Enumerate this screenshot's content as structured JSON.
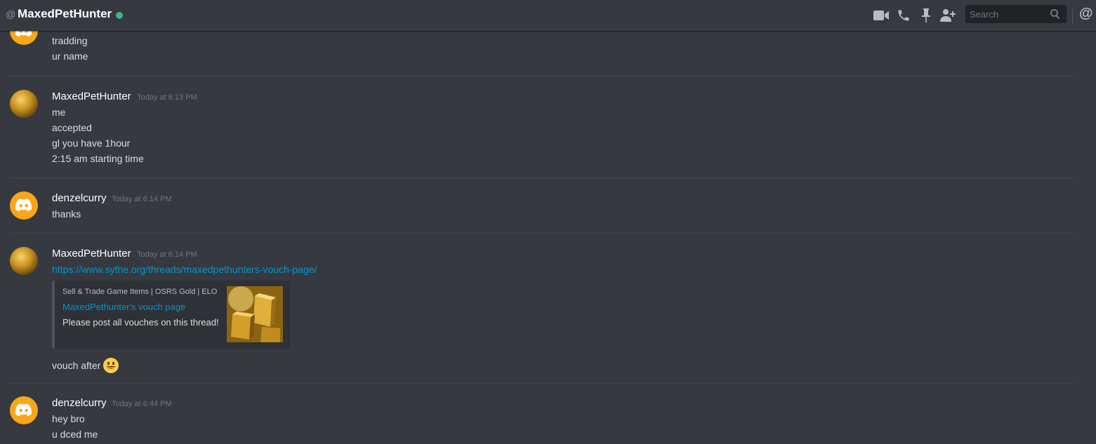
{
  "header": {
    "at_symbol": "@",
    "channel_name": "MaxedPetHunter",
    "status_color": "#43b581",
    "icons": [
      "video-call-icon",
      "voice-call-icon",
      "pin-icon",
      "add-friend-icon"
    ],
    "search_placeholder": "Search",
    "mention_symbol": "@"
  },
  "colors": {
    "background": "#36393f",
    "link": "#0096cf",
    "discord_avatar": "#faa61a",
    "online": "#43b581"
  },
  "messages": [
    {
      "author": "",
      "avatar": "discord-default",
      "lines": [
        "tradding",
        "ur name"
      ]
    },
    {
      "author": "MaxedPetHunter",
      "timestamp": "Today at 6:13 PM",
      "avatar": "gold-bars",
      "lines": [
        "me",
        "accepted",
        "gl you have 1hour",
        "2:15 am starting time"
      ]
    },
    {
      "author": "denzelcurry",
      "timestamp": "Today at 6:14 PM",
      "avatar": "discord-default",
      "lines": [
        "thanks"
      ]
    },
    {
      "author": "MaxedPetHunter",
      "timestamp": "Today at 6:14 PM",
      "avatar": "gold-bars",
      "link": "https://www.sythe.org/threads/maxedpethunters-vouch-page/",
      "embed": {
        "provider": "Sell & Trade Game Items | OSRS Gold | ELO",
        "title": "MaxedPethunter's vouch page",
        "description": "Please post all vouches on this thread!"
      },
      "after_text": "vouch after",
      "emoji": "smiley"
    },
    {
      "author": "denzelcurry",
      "timestamp": "Today at 6:44 PM",
      "avatar": "discord-default",
      "lines": [
        "hey bro",
        "u dced me"
      ]
    }
  ]
}
